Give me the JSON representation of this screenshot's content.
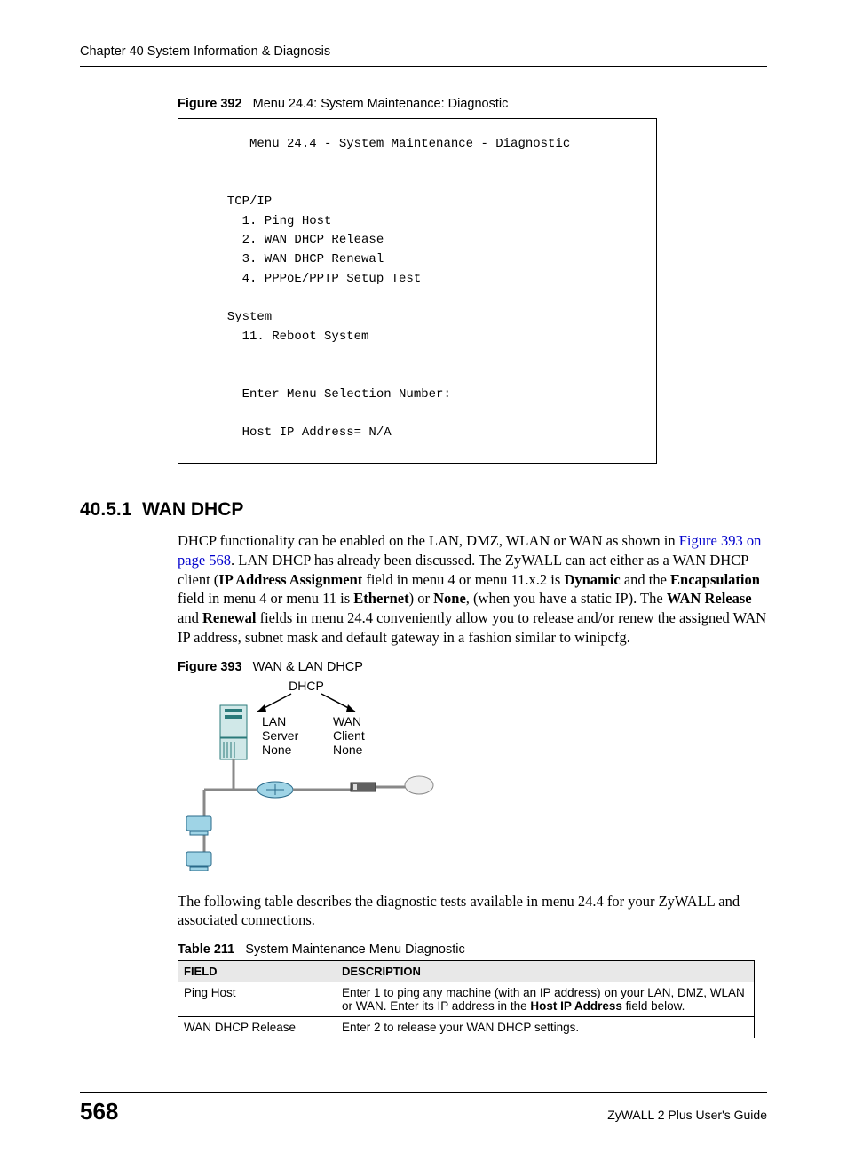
{
  "header": "Chapter 40 System Information & Diagnosis",
  "fig392": {
    "label": "Figure 392",
    "title": "Menu 24.4: System Maintenance: Diagnostic",
    "console": "     Menu 24.4 - System Maintenance - Diagnostic\n\n\n  TCP/IP\n    1. Ping Host\n    2. WAN DHCP Release\n    3. WAN DHCP Renewal\n    4. PPPoE/PPTP Setup Test\n\n  System\n    11. Reboot System\n\n\n    Enter Menu Selection Number:\n\n    Host IP Address= N/A"
  },
  "section": {
    "num": "40.5.1",
    "title": "WAN DHCP",
    "p1a": "DHCP functionality can be enabled on the LAN, DMZ, WLAN or WAN as shown in ",
    "link": "Figure 393 on page 568",
    "p1b": ". LAN DHCP has already been discussed. The ZyWALL can act either as a WAN DHCP client (",
    "b1": "IP Address Assignment",
    "p1c": " field in menu 4 or menu 11.x.2 is ",
    "b2": "Dynamic",
    "p1d": " and the ",
    "b3": "Encapsulation",
    "p1e": " field in menu 4 or menu 11 is ",
    "b4": "Ethernet",
    "p1f": ") or ",
    "b5": "None",
    "p1g": ", (when you have a static IP). The ",
    "b6": "WAN Release",
    "p1h": " and ",
    "b7": "Renewal",
    "p1i": " fields in menu 24.4 conveniently allow you to release and/or renew the assigned WAN IP address, subnet mask and default gateway in a fashion similar to winipcfg."
  },
  "fig393": {
    "label": "Figure 393",
    "title": "WAN & LAN DHCP",
    "diagram": {
      "top": "DHCP",
      "left1": "LAN",
      "left2": "Server",
      "left3": "None",
      "right1": "WAN",
      "right2": "Client",
      "right3": "None"
    }
  },
  "p2": "The following table describes the diagnostic tests available in menu 24.4 for your ZyWALL and associated connections.",
  "table": {
    "label": "Table 211",
    "title": "System Maintenance Menu Diagnostic",
    "headers": [
      "FIELD",
      "DESCRIPTION"
    ],
    "rows": [
      {
        "field": "Ping Host",
        "desc_a": "Enter 1 to ping any machine (with an IP address) on your LAN, DMZ, WLAN or WAN. Enter its IP address in the ",
        "desc_b": "Host IP Address",
        "desc_c": " field below."
      },
      {
        "field": "WAN DHCP Release",
        "desc_a": "Enter 2 to release your WAN DHCP settings.",
        "desc_b": "",
        "desc_c": ""
      }
    ]
  },
  "footer": {
    "page": "568",
    "guide": "ZyWALL 2 Plus User's Guide"
  }
}
